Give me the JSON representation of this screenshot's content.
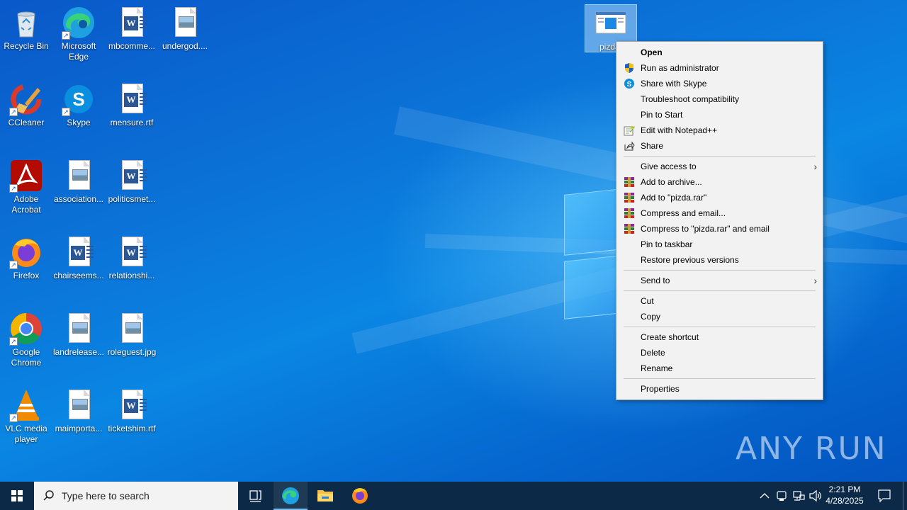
{
  "desktop": {
    "icons": [
      {
        "label": "Recycle Bin",
        "kind": "recycle-bin"
      },
      {
        "label": "Microsoft Edge",
        "kind": "edge"
      },
      {
        "label": "mbcomme...",
        "kind": "word"
      },
      {
        "label": "undergod....",
        "kind": "image"
      },
      {
        "label": "CCleaner",
        "kind": "ccleaner"
      },
      {
        "label": "Skype",
        "kind": "skype"
      },
      {
        "label": "mensure.rtf",
        "kind": "word"
      },
      {
        "label": "Adobe Acrobat",
        "kind": "acrobat"
      },
      {
        "label": "association...",
        "kind": "image"
      },
      {
        "label": "politicsmet...",
        "kind": "word"
      },
      {
        "label": "Firefox",
        "kind": "firefox"
      },
      {
        "label": "chairseems...",
        "kind": "word"
      },
      {
        "label": "relationshi...",
        "kind": "word"
      },
      {
        "label": "Google Chrome",
        "kind": "chrome"
      },
      {
        "label": "landrelease...",
        "kind": "image"
      },
      {
        "label": "roleguest.jpg",
        "kind": "image"
      },
      {
        "label": "VLC media player",
        "kind": "vlc"
      },
      {
        "label": "maimporta...",
        "kind": "image"
      },
      {
        "label": "ticketshim.rtf",
        "kind": "word"
      }
    ],
    "selected_icon": {
      "label": "pizda.",
      "kind": "exe"
    }
  },
  "context_menu": {
    "items": [
      {
        "label": "Open",
        "bold": true,
        "icon": ""
      },
      {
        "label": "Run as administrator",
        "icon": "uac-shield-icon"
      },
      {
        "label": "Share with Skype",
        "icon": "skype-icon"
      },
      {
        "label": "Troubleshoot compatibility",
        "icon": ""
      },
      {
        "label": "Pin to Start",
        "icon": ""
      },
      {
        "label": "Edit with Notepad++",
        "icon": "notepadpp-icon"
      },
      {
        "label": "Share",
        "icon": "share-icon"
      },
      {
        "label": "Give access to",
        "icon": "",
        "submenu": true
      },
      {
        "label": "Add to archive...",
        "icon": "winrar-icon"
      },
      {
        "label": "Add to \"pizda.rar\"",
        "icon": "winrar-icon"
      },
      {
        "label": "Compress and email...",
        "icon": "winrar-icon"
      },
      {
        "label": "Compress to \"pizda.rar\" and email",
        "icon": "winrar-icon"
      },
      {
        "label": "Pin to taskbar",
        "icon": ""
      },
      {
        "label": "Restore previous versions",
        "icon": ""
      },
      {
        "label": "Send to",
        "icon": "",
        "submenu": true
      },
      {
        "label": "Cut",
        "icon": ""
      },
      {
        "label": "Copy",
        "icon": ""
      },
      {
        "label": "Create shortcut",
        "icon": ""
      },
      {
        "label": "Delete",
        "icon": ""
      },
      {
        "label": "Rename",
        "icon": ""
      },
      {
        "label": "Properties",
        "icon": ""
      }
    ]
  },
  "taskbar": {
    "search_placeholder": "Type here to search",
    "time": "2:21 PM",
    "date": "4/28/2025",
    "pinned": [
      "task-view-icon",
      "edge-icon",
      "file-explorer-icon",
      "firefox-icon"
    ]
  },
  "watermark": "ANY RUN",
  "colors": {
    "desktop_blue": "#0a78dc",
    "taskbar": "#0c2a47",
    "menu_bg": "#f2f2f2",
    "selection": "#cce8ff"
  }
}
